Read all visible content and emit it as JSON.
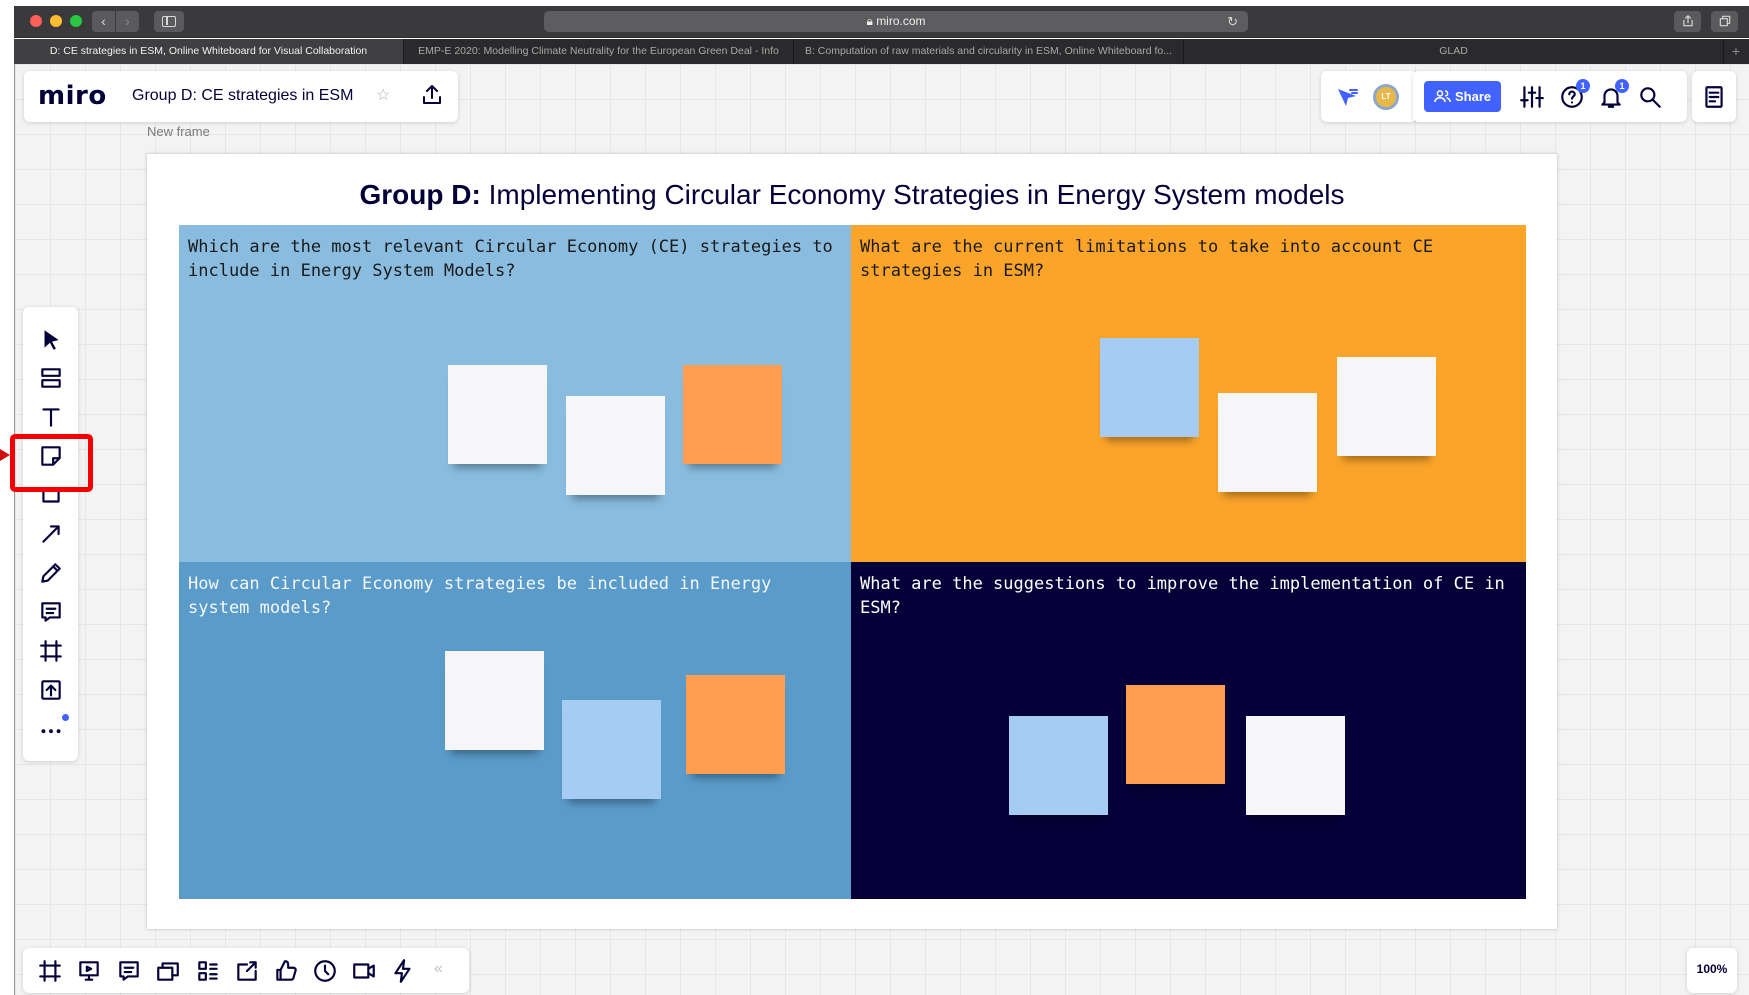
{
  "browser": {
    "url": "miro.com",
    "tabs": [
      {
        "label": "D: CE strategies in ESM, Online Whiteboard for Visual Collaboration",
        "active": true
      },
      {
        "label": "EMP-E 2020: Modelling Climate Neutrality for the European Green Deal  - Info",
        "active": false
      },
      {
        "label": "B: Computation of raw materials and circularity in ESM, Online Whiteboard fo...",
        "active": false
      },
      {
        "label": "GLAD",
        "active": false
      }
    ],
    "new_tab_glyph": "+"
  },
  "app": {
    "logo": "miro",
    "board_title": "Group D: CE strategies in ESM",
    "avatar_initials": "LT",
    "share_label": "Share",
    "help_badge": "1",
    "notifications_badge": "1",
    "zoom": "100%"
  },
  "frame": {
    "label": "New frame",
    "title_bold": "Group D:",
    "title_rest": " Implementing Circular Economy Strategies in Energy System models",
    "quadrants": [
      {
        "question": "Which are the most relevant Circular Economy (CE) strategies to include in Energy System Models?",
        "color": "#89bcdf"
      },
      {
        "question": "What are the current limitations to take into account CE strategies in ESM?",
        "color": "#fba42a"
      },
      {
        "question": "How can Circular Economy strategies be included in Energy system models?",
        "color": "#5b9bca"
      },
      {
        "question": "What are the suggestions to improve the implementation of CE in ESM?",
        "color": "#050038"
      }
    ]
  },
  "sticky_colors": {
    "white": "#f6f6f8",
    "blue": "#a6ccf3",
    "orange": "#ff9d50"
  },
  "left_toolbar": [
    "select-icon",
    "templates-icon",
    "text-icon",
    "sticky-note-icon",
    "shape-icon",
    "connection-line-icon",
    "pen-icon",
    "comment-icon",
    "frame-icon",
    "upload-icon",
    "more-tools-icon"
  ],
  "bottom_toolbar": [
    "frames-icon",
    "presentation-icon",
    "comments-icon",
    "card-icon",
    "kanban-icon",
    "share-screen-icon",
    "voting-icon",
    "timer-icon",
    "video-chat-icon",
    "activity-icon"
  ],
  "highlight_color": "#f40000"
}
